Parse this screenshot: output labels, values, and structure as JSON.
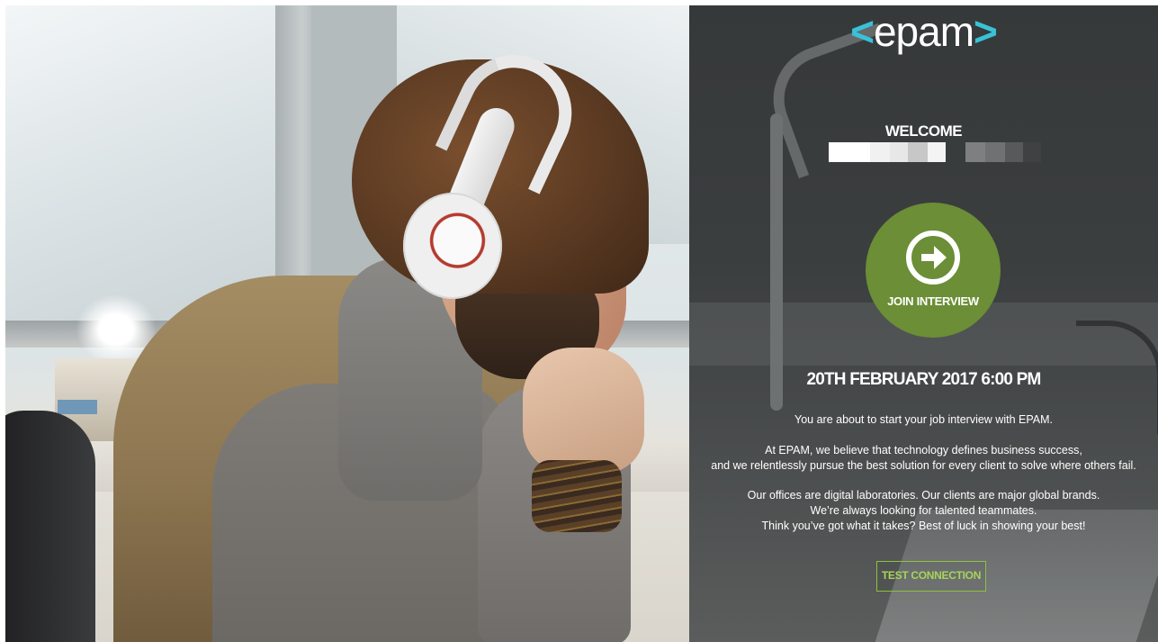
{
  "brand": {
    "logo_left": "<",
    "logo_word": "epam",
    "logo_right": ">",
    "accent_color": "#39c2d7",
    "button_color": "#6b8e36",
    "test_button_color": "#8fc13e"
  },
  "welcome": {
    "heading": "WELCOME"
  },
  "join": {
    "label": "JOIN INTERVIEW",
    "icon": "arrow-right-circle-icon"
  },
  "schedule": {
    "datetime": "20TH FEBRUARY 2017 6:00 PM"
  },
  "messages": {
    "intro": "You are about to start your job interview with EPAM.",
    "belief_line1": "At EPAM, we believe that technology defines business success,",
    "belief_line2": "and we relentlessly pursue the best solution for every client to solve where others fail.",
    "offices_line1": "Our offices are digital laboratories. Our clients are major global brands.",
    "offices_line2": "We’re always looking for talented teammates.",
    "offices_line3": "Think you’ve got what it takes? Best of luck in showing your best!"
  },
  "test": {
    "label": "TEST CONNECTION"
  }
}
